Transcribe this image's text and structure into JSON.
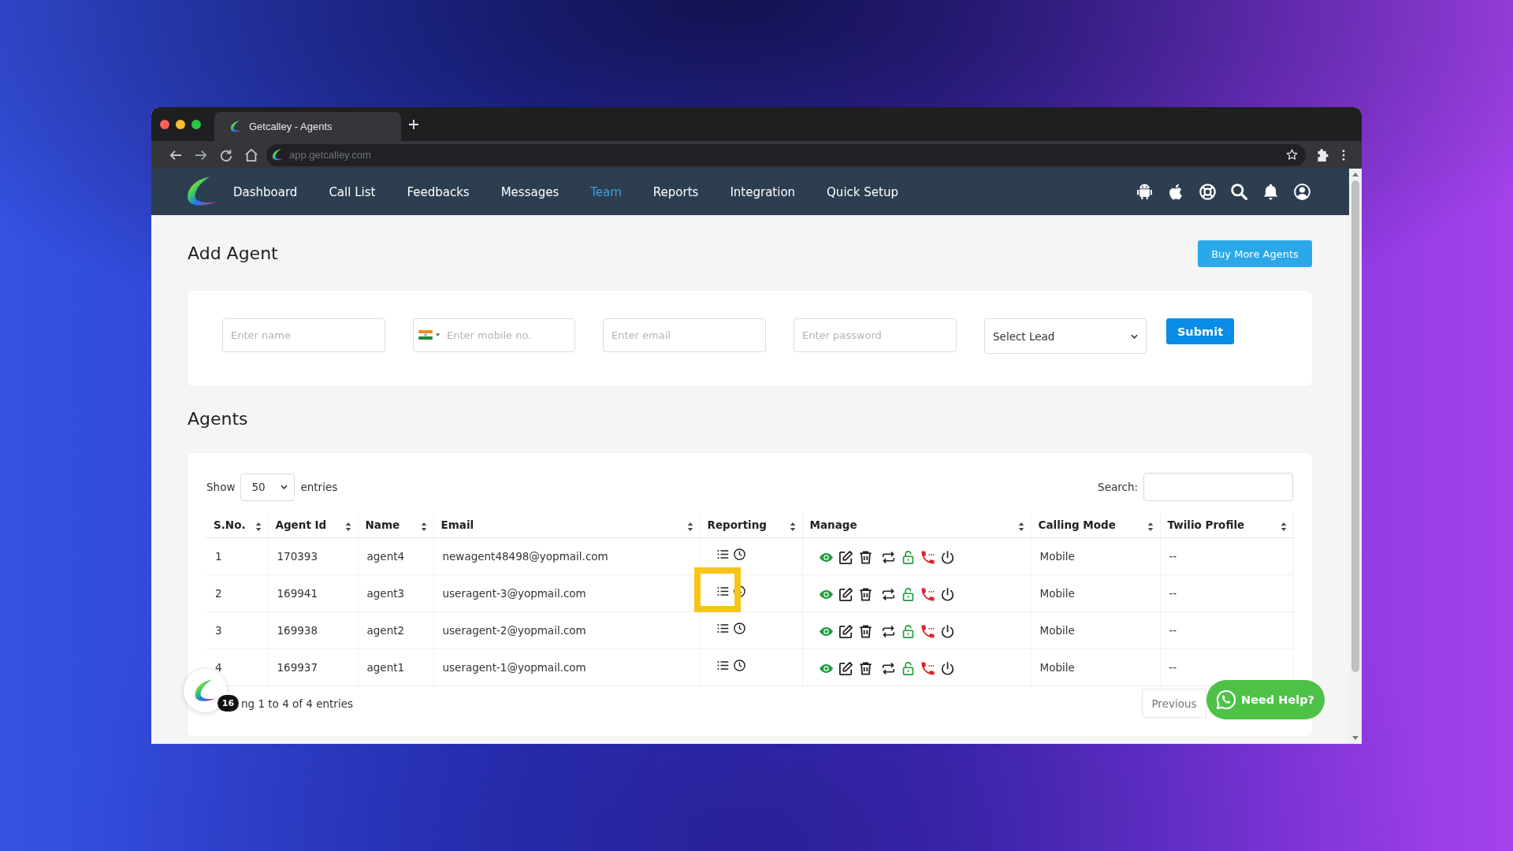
{
  "browser": {
    "tab_title": "Getcalley - Agents",
    "url": "app.getcalley.com"
  },
  "nav": {
    "items": [
      {
        "label": "Dashboard",
        "selected": false
      },
      {
        "label": "Call List",
        "selected": false
      },
      {
        "label": "Feedbacks",
        "selected": false
      },
      {
        "label": "Messages",
        "selected": false
      },
      {
        "label": "Team",
        "selected": true
      },
      {
        "label": "Reports",
        "selected": false
      },
      {
        "label": "Integration",
        "selected": false
      },
      {
        "label": "Quick Setup",
        "selected": false
      }
    ]
  },
  "add_agent": {
    "title": "Add Agent",
    "buy_button": "Buy More Agents",
    "fields": [
      {
        "kind": "text",
        "placeholder": "Enter name"
      },
      {
        "kind": "phone",
        "placeholder": "Enter mobile no."
      },
      {
        "kind": "email",
        "placeholder": "Enter email"
      },
      {
        "kind": "password",
        "placeholder": "Enter password"
      },
      {
        "kind": "select",
        "value": "Select Lead"
      }
    ],
    "submit": "Submit"
  },
  "agents": {
    "title": "Agents",
    "show_label": "Show",
    "page_size": "50",
    "entries_label": "entries",
    "search_label": "Search:",
    "columns": [
      "S.No.",
      "Agent Id",
      "Name",
      "Email",
      "Reporting",
      "Manage",
      "Calling Mode",
      "Twilio Profile"
    ],
    "rows": [
      {
        "sno": "1",
        "agent_id": "170393",
        "name": "agent4",
        "email": "newagent48498@yopmail.com",
        "calling_mode": "Mobile",
        "twilio_profile": "--",
        "highlighted": false
      },
      {
        "sno": "2",
        "agent_id": "169941",
        "name": "agent3",
        "email": "useragent-3@yopmail.com",
        "calling_mode": "Mobile",
        "twilio_profile": "--",
        "highlighted": true
      },
      {
        "sno": "3",
        "agent_id": "169938",
        "name": "agent2",
        "email": "useragent-2@yopmail.com",
        "calling_mode": "Mobile",
        "twilio_profile": "--",
        "highlighted": false
      },
      {
        "sno": "4",
        "agent_id": "169937",
        "name": "agent1",
        "email": "useragent-1@yopmail.com",
        "calling_mode": "Mobile",
        "twilio_profile": "--",
        "highlighted": false
      }
    ],
    "info": "ng 1 to 4 of 4 entries",
    "previous_button": "Previous"
  },
  "launcher": {
    "badge": "16"
  },
  "help_button": {
    "label": "Need Help?"
  }
}
